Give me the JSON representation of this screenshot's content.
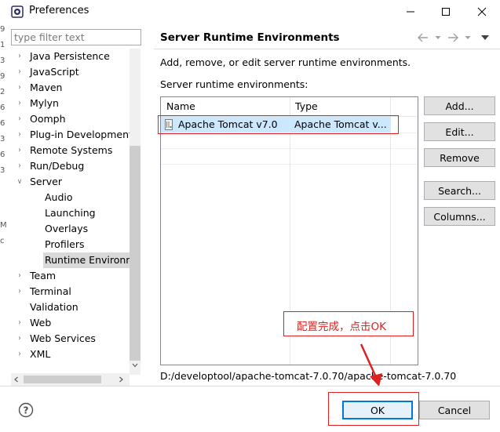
{
  "window": {
    "title": "Preferences",
    "controls": {
      "minimize": "minimize-icon",
      "maximize": "maximize-icon",
      "close": "close-icon"
    }
  },
  "edge_fragment": {
    "chars": [
      "9",
      "1",
      "3",
      "9",
      "2",
      "6",
      "6",
      "3",
      "6",
      "3",
      "M",
      "c"
    ]
  },
  "filter": {
    "placeholder": "type filter text",
    "value": ""
  },
  "tree": {
    "items": [
      {
        "label": "Java Persistence"
      },
      {
        "label": "JavaScript"
      },
      {
        "label": "Maven"
      },
      {
        "label": "Mylyn"
      },
      {
        "label": "Oomph"
      },
      {
        "label": "Plug-in Development"
      },
      {
        "label": "Remote Systems"
      },
      {
        "label": "Run/Debug"
      },
      {
        "label": "Server"
      },
      {
        "label": "Audio"
      },
      {
        "label": "Launching"
      },
      {
        "label": "Overlays"
      },
      {
        "label": "Profilers"
      },
      {
        "label": "Runtime Environments"
      },
      {
        "label": "Team"
      },
      {
        "label": "Terminal"
      },
      {
        "label": "Validation"
      },
      {
        "label": "Web"
      },
      {
        "label": "Web Services"
      },
      {
        "label": "XML"
      }
    ],
    "selected": "Runtime Environments"
  },
  "page": {
    "title": "Server Runtime Environments",
    "nav_icons": [
      "back-arrow-icon",
      "dropdown-icon",
      "forward-arrow-icon",
      "dropdown-icon",
      "view-menu-icon"
    ],
    "description": "Add, remove, or edit server runtime environments.",
    "list_label": "Server runtime environments:"
  },
  "table": {
    "columns": [
      "Name",
      "Type"
    ],
    "rows": [
      {
        "name": "Apache Tomcat v7.0",
        "type": "Apache Tomcat v...",
        "selected": true
      }
    ]
  },
  "buttons": {
    "add": "Add...",
    "edit": "Edit...",
    "remove": "Remove",
    "search": "Search...",
    "columns": "Columns...",
    "ok": "OK",
    "cancel": "Cancel"
  },
  "location_path": "D:/developtool/apache-tomcat-7.0.70/apache-tomcat-7.0.70",
  "annotation": {
    "note": "配置完成，点击OK",
    "color": "#e02020"
  },
  "colors": {
    "selection": "#cce8ff",
    "tree_selection": "#d9d9d9",
    "default_button_border": "#0078d7"
  }
}
